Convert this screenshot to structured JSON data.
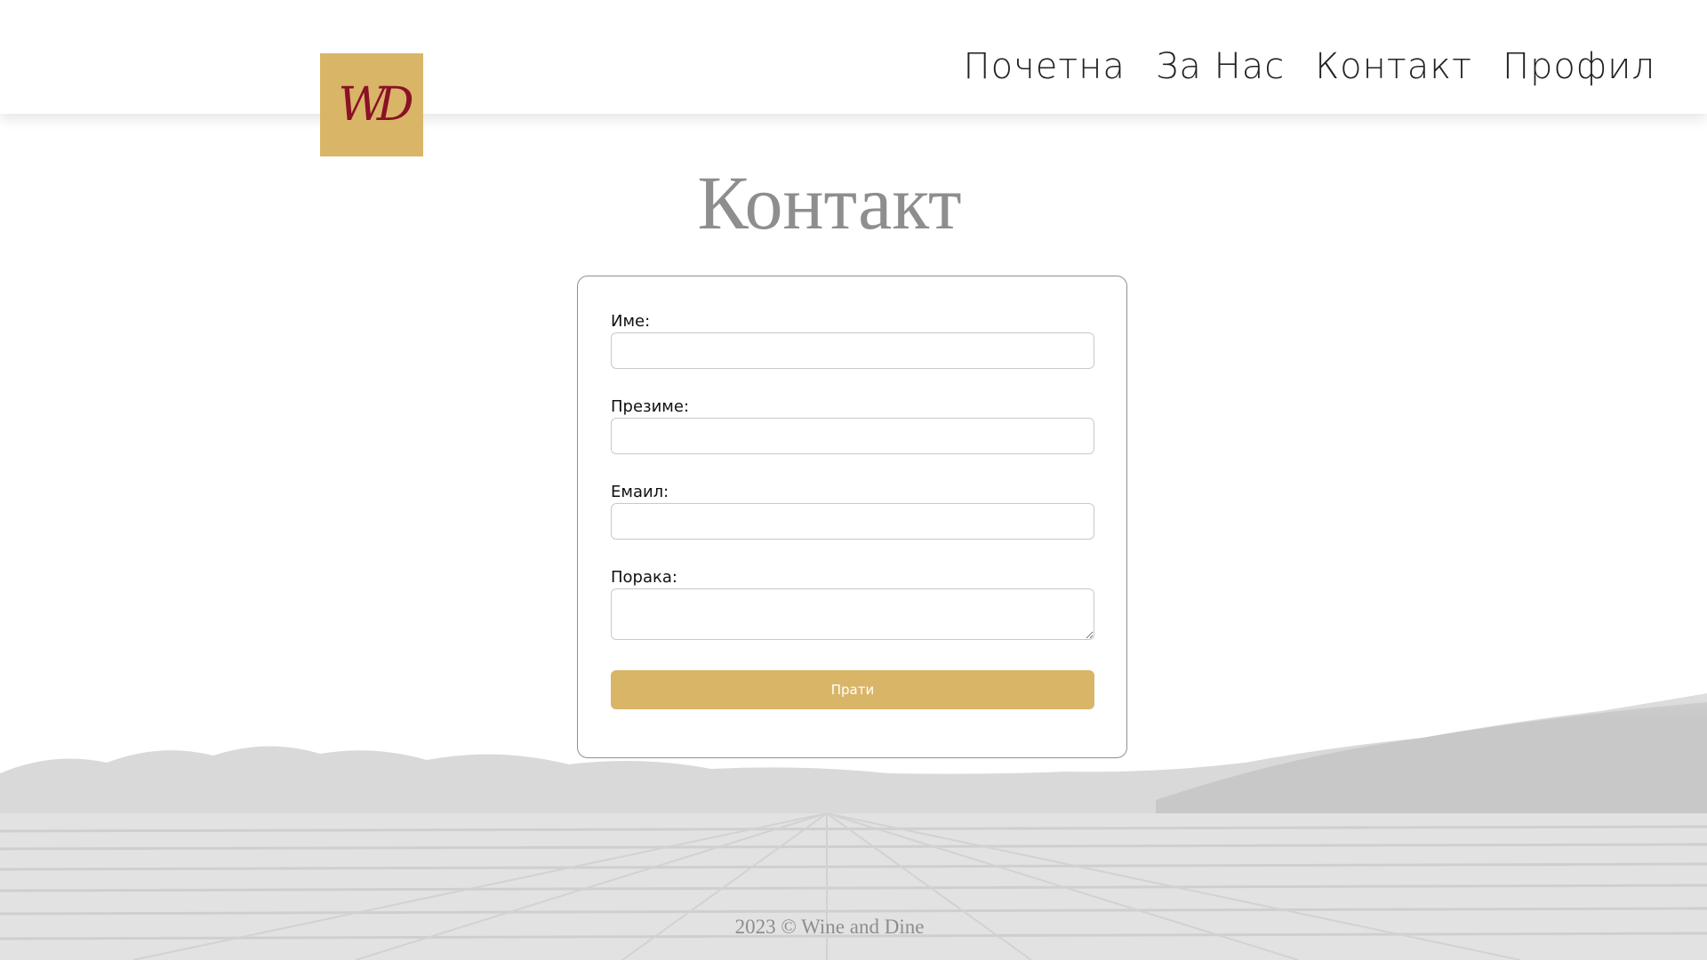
{
  "logo": {
    "monogram": "WD",
    "background_color": "#d9b567",
    "text_color": "#8a1126"
  },
  "nav": {
    "items": [
      {
        "label": "Почетна"
      },
      {
        "label": "За Нас"
      },
      {
        "label": "Контакт"
      },
      {
        "label": "Профил"
      }
    ]
  },
  "page": {
    "title": "Контакт"
  },
  "form": {
    "fields": [
      {
        "label": "Име:",
        "value": "",
        "type": "text"
      },
      {
        "label": "Презиме:",
        "value": "",
        "type": "text"
      },
      {
        "label": "Емаил:",
        "value": "",
        "type": "email"
      },
      {
        "label": "Порака:",
        "value": "",
        "type": "textarea"
      }
    ],
    "submit_label": "Прати",
    "accent_color": "#d9b567"
  },
  "footer": {
    "text": "2023 © Wine and Dine"
  }
}
